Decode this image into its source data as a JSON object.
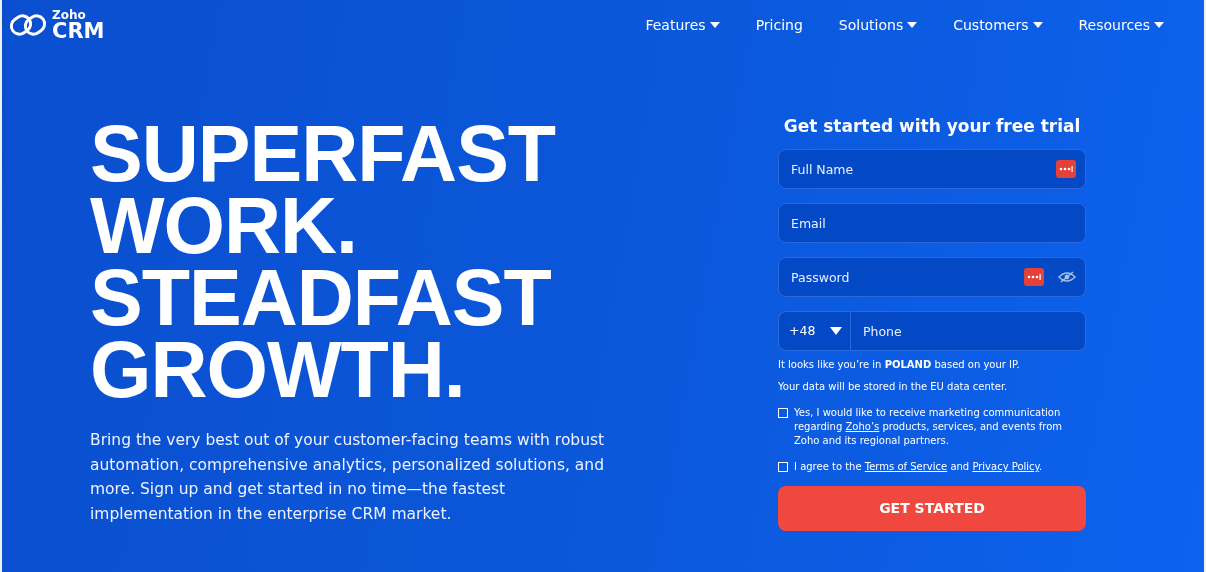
{
  "logo": {
    "brand": "Zoho",
    "product": "CRM"
  },
  "nav": [
    {
      "label": "Features",
      "dropdown": true
    },
    {
      "label": "Pricing",
      "dropdown": false
    },
    {
      "label": "Solutions",
      "dropdown": true
    },
    {
      "label": "Customers",
      "dropdown": true
    },
    {
      "label": "Resources",
      "dropdown": true
    }
  ],
  "hero": {
    "headline": [
      "SUPERFAST",
      "WORK.",
      "STEADFAST",
      "GROWTH."
    ],
    "description": "Bring the very best out of your customer-facing teams with robust automation, comprehensive analytics, personalized solutions, and more. Sign up and get started in no time—the fastest implementation in the enterprise CRM market."
  },
  "form": {
    "title": "Get started with your free trial",
    "fields": [
      {
        "kind": "text",
        "placeholder": "Full Name",
        "autofill_badge": true,
        "reveal_toggle": false
      },
      {
        "kind": "text",
        "placeholder": "Email",
        "autofill_badge": false,
        "reveal_toggle": false
      },
      {
        "kind": "password",
        "placeholder": "Password",
        "autofill_badge": true,
        "reveal_toggle": true
      },
      {
        "kind": "phone",
        "country_code": "+48",
        "placeholder": "Phone",
        "autofill_badge": false,
        "reveal_toggle": false
      }
    ],
    "notes": [
      "It looks like you’re in **POLAND** based on your IP.",
      "Your data will be stored in the EU data center."
    ],
    "consents": [
      {
        "checked": false,
        "parts": [
          {
            "text": "Yes, I would like to receive marketing communication regarding ",
            "kind": "text"
          },
          {
            "text": "Zoho’s",
            "kind": "link"
          },
          {
            "text": " products, services, and events from Zoho and its regional partners.",
            "kind": "text"
          }
        ]
      },
      {
        "checked": false,
        "parts": [
          {
            "text": "I agree to the ",
            "kind": "text"
          },
          {
            "text": "Terms of Service",
            "kind": "link"
          },
          {
            "text": " and ",
            "kind": "text"
          },
          {
            "text": "Privacy Policy",
            "kind": "link"
          },
          {
            "text": ".",
            "kind": "text"
          }
        ]
      }
    ],
    "submit": "GET STARTED"
  }
}
